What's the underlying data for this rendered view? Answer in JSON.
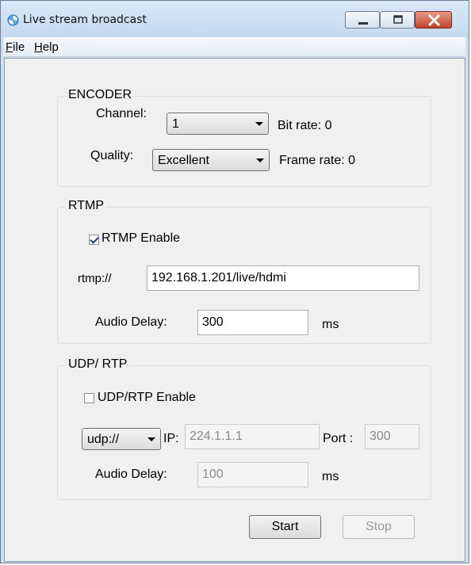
{
  "window": {
    "title": "Live stream broadcast",
    "icon": "swirl-app-icon"
  },
  "menu": {
    "file": {
      "accel": "F",
      "rest": "ile"
    },
    "help": {
      "accel": "H",
      "rest": "elp"
    }
  },
  "encoder": {
    "legend": "ENCODER",
    "channel_label": "Channel:",
    "channel_value": "1",
    "bitrate_label": "Bit rate: 0",
    "quality_label": "Quality:",
    "quality_value": "Excellent",
    "framerate_label": "Frame rate:  0"
  },
  "rtmp": {
    "legend": "RTMP",
    "enable_label": "RTMP Enable",
    "enabled": true,
    "url_label": "rtmp://",
    "url_value": "192.168.1.201/live/hdmi",
    "audio_delay_label": "Audio Delay:",
    "audio_delay_value": "300",
    "ms_label": "ms"
  },
  "udp": {
    "legend": "UDP/ RTP",
    "enable_label": "UDP/RTP Enable",
    "enabled": false,
    "protocol_value": "udp://",
    "ip_label": "IP:",
    "ip_value": "224.1.1.1",
    "port_label": "Port :",
    "port_value": "300",
    "audio_delay_label": "Audio Delay:",
    "audio_delay_value": "100",
    "ms_label": "ms"
  },
  "actions": {
    "start_label": "Start",
    "stop_label": "Stop"
  }
}
